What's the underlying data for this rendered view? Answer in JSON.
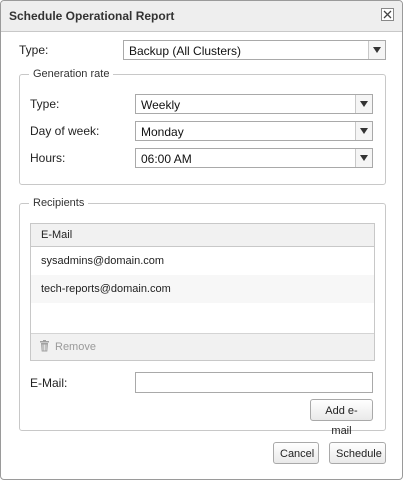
{
  "dialog": {
    "title": "Schedule Operational Report",
    "close_icon": "close-icon"
  },
  "report": {
    "type_label": "Type:",
    "type_value": "Backup (All Clusters)"
  },
  "generation_rate": {
    "legend": "Generation rate",
    "type_label": "Type:",
    "type_value": "Weekly",
    "day_label": "Day of week:",
    "day_value": "Monday",
    "hours_label": "Hours:",
    "hours_value": "06:00 AM"
  },
  "recipients": {
    "legend": "Recipients",
    "column_header": "E-Mail",
    "emails": [
      "sysadmins@domain.com",
      "tech-reports@domain.com"
    ],
    "remove_label": "Remove",
    "remove_icon": "trash-icon",
    "email_label": "E-Mail:",
    "email_value": "",
    "add_label": "Add e-mail"
  },
  "footer": {
    "cancel_label": "Cancel",
    "schedule_label": "Schedule"
  }
}
